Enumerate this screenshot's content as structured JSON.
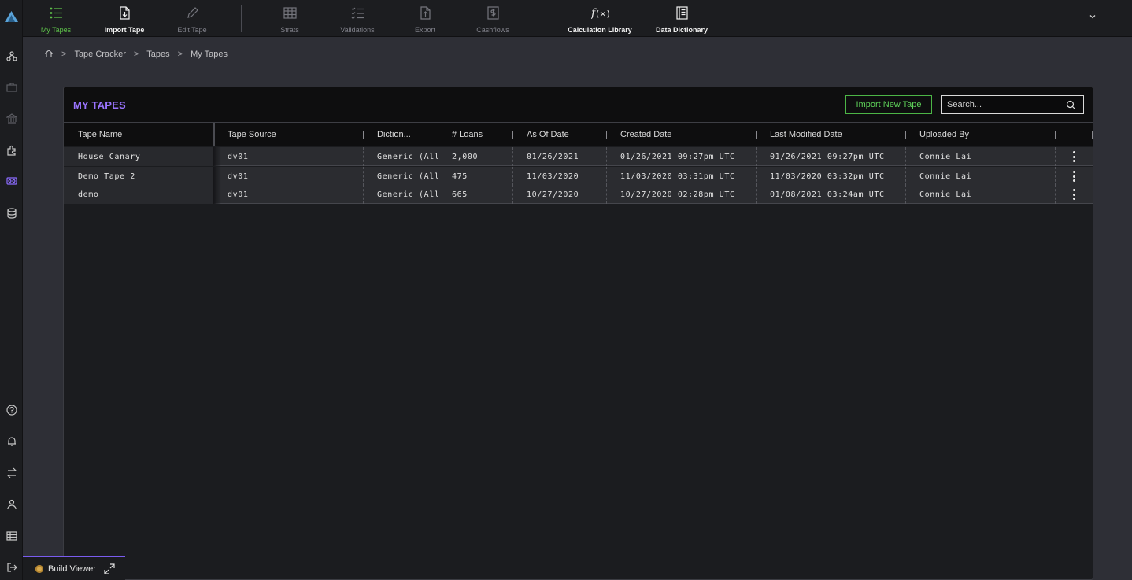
{
  "toolbar": {
    "items": [
      {
        "label": "My Tapes",
        "icon": "list-icon",
        "state": "active"
      },
      {
        "label": "Import Tape",
        "icon": "file-import-icon",
        "state": "enabled"
      },
      {
        "label": "Edit Tape",
        "icon": "pencil-icon",
        "state": "disabled"
      },
      {
        "label": "Strats",
        "icon": "grid-table-icon",
        "state": "disabled"
      },
      {
        "label": "Validations",
        "icon": "checklist-icon",
        "state": "disabled"
      },
      {
        "label": "Export",
        "icon": "file-export-icon",
        "state": "disabled"
      },
      {
        "label": "Cashflows",
        "icon": "dollar-doc-icon",
        "state": "disabled"
      },
      {
        "label": "Calculation Library",
        "icon": "function-icon",
        "state": "enabled"
      },
      {
        "label": "Data Dictionary",
        "icon": "book-icon",
        "state": "enabled"
      }
    ]
  },
  "breadcrumb": {
    "items": [
      "Tape Cracker",
      "Tapes",
      "My Tapes"
    ],
    "separator": ">"
  },
  "panel": {
    "title": "MY TAPES",
    "import_button": "Import New Tape",
    "search_placeholder": "Search..."
  },
  "table": {
    "columns": [
      "Tape Name",
      "Tape Source",
      "Diction...",
      "# Loans",
      "As Of Date",
      "Created Date",
      "Last Modified Date",
      "Uploaded By"
    ],
    "rows": [
      {
        "name": "House Canary",
        "source": "dv01",
        "dictionary": "Generic (All",
        "loans": "2,000",
        "as_of": "01/26/2021",
        "created": "01/26/2021 09:27pm UTC",
        "modified": "01/26/2021 09:27pm UTC",
        "uploaded_by": "Connie Lai"
      },
      {
        "name": "Demo Tape 2",
        "source": "dv01",
        "dictionary": "Generic (All",
        "loans": "475",
        "as_of": "11/03/2020",
        "created": "11/03/2020 03:31pm UTC",
        "modified": "11/03/2020 03:32pm UTC",
        "uploaded_by": "Connie Lai"
      },
      {
        "name": "demo",
        "source": "dv01",
        "dictionary": "Generic (All",
        "loans": "665",
        "as_of": "10/27/2020",
        "created": "10/27/2020 02:28pm UTC",
        "modified": "01/08/2021 03:24am UTC",
        "uploaded_by": "Connie Lai"
      }
    ]
  },
  "build_viewer": {
    "label": "Build Viewer"
  },
  "colors": {
    "accent_purple": "#9a74ff",
    "accent_green": "#5fd35a",
    "background": "#2e2f36"
  }
}
